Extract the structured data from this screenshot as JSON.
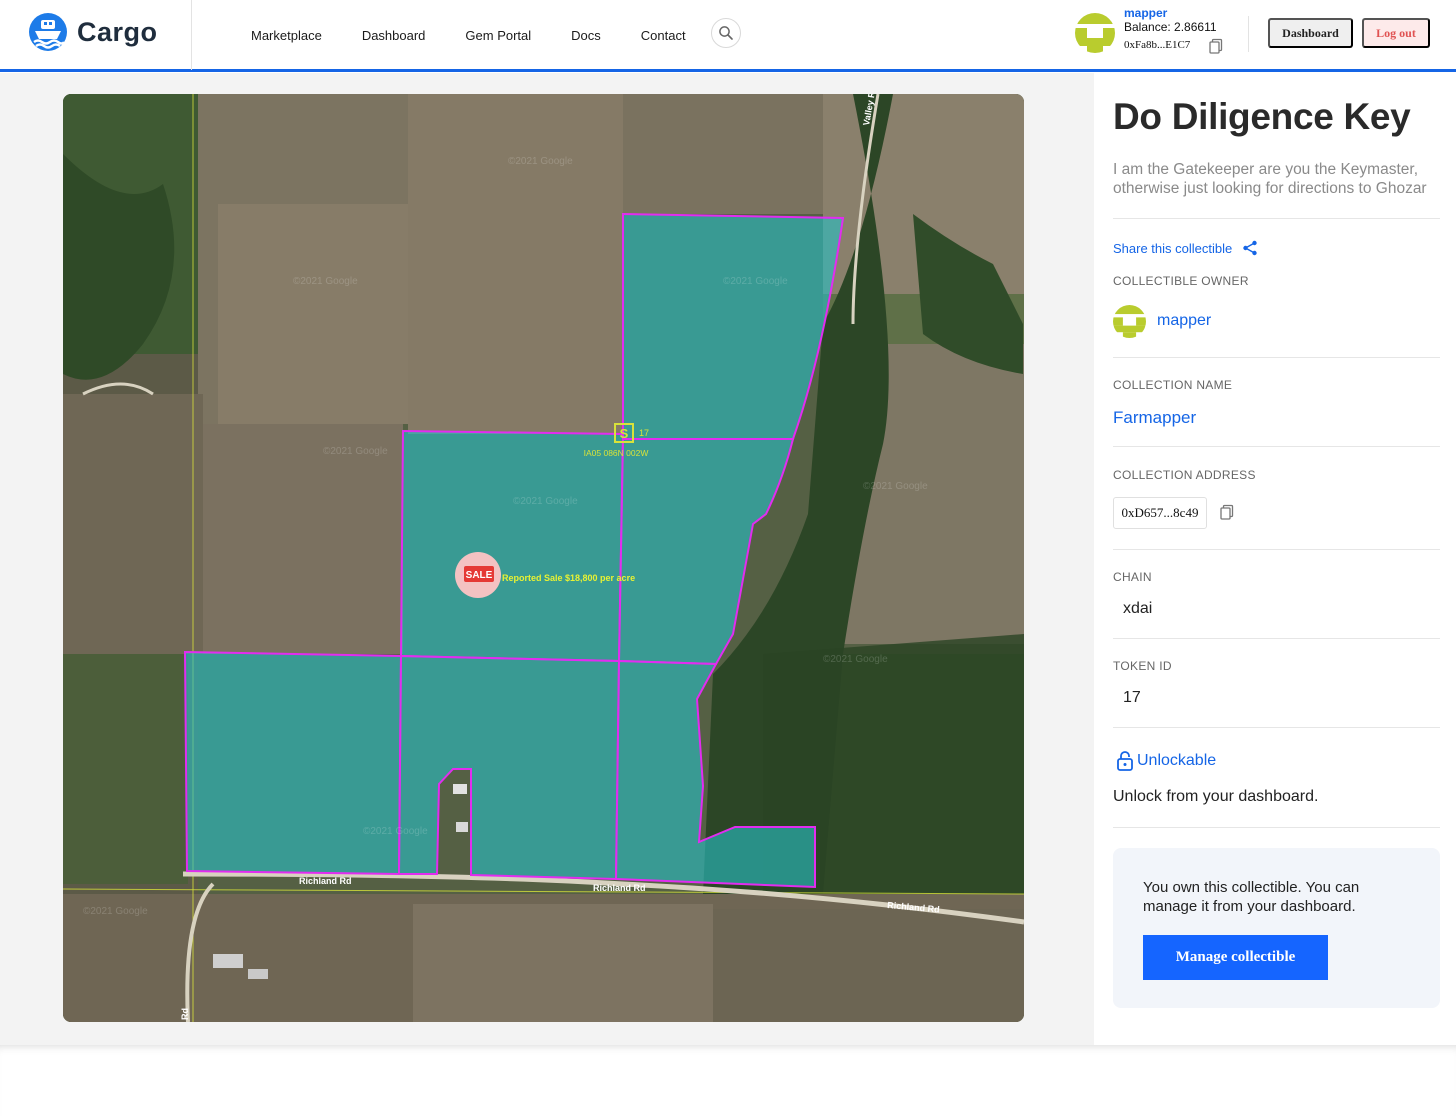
{
  "header": {
    "logo_text": "Cargo",
    "nav": [
      "Marketplace",
      "Dashboard",
      "Gem Portal",
      "Docs",
      "Contact"
    ],
    "user": {
      "name": "mapper",
      "balance": "Balance: 2.86611",
      "address": "0xFa8b...E1C7"
    },
    "dashboard_button": "Dashboard",
    "logout_button": "Log out"
  },
  "map": {
    "section_badge": "S",
    "section_number": "17",
    "section_code": "IA05 086N 002W",
    "sale_badge": "SALE",
    "sale_label": "Reported Sale $18,800 per acre",
    "road_labels": [
      "Richland Rd",
      "Richland Rd",
      "Richland Rd",
      "Valley R",
      "Rd"
    ],
    "watermark": "©2021 Google",
    "colors": {
      "parcel_fill": "#28bfc3",
      "parcel_border": "#e22cf0",
      "section_line": "#d8e23a"
    }
  },
  "detail": {
    "title": "Do Diligence Key",
    "description": "I am the Gatekeeper are you the Keymaster, otherwise just looking for directions to Ghozar",
    "share_label": "Share this collectible",
    "owner_label": "COLLECTIBLE OWNER",
    "owner_name": "mapper",
    "collection_name_label": "COLLECTION NAME",
    "collection_name": "Farmapper",
    "collection_address_label": "COLLECTION ADDRESS",
    "collection_address": "0xD657...8c49",
    "chain_label": "CHAIN",
    "chain": "xdai",
    "token_id_label": "TOKEN ID",
    "token_id": "17",
    "unlockable_label": "Unlockable",
    "unlockable_text": "Unlock from your dashboard.",
    "own_text": "You own this collectible. You can manage it from your dashboard.",
    "manage_button": "Manage collectible"
  },
  "colors": {
    "accent": "#1565e6",
    "button": "#1565ff",
    "logout": "#e05252"
  }
}
